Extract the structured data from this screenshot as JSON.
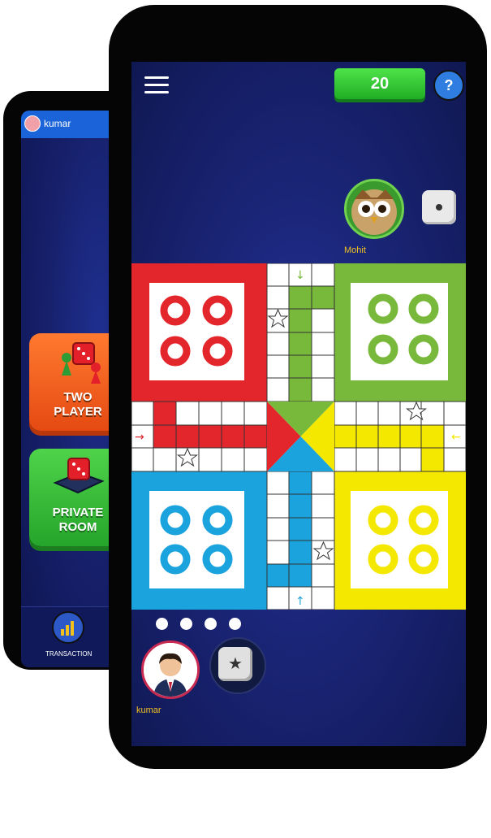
{
  "back_screen": {
    "username": "kumar",
    "modes": [
      {
        "label_line1": "TWO",
        "label_line2": "PLAYER"
      },
      {
        "label_line1": "PRIVATE",
        "label_line2": "ROOM"
      }
    ],
    "bottom_nav": {
      "transaction_label": "TRANSACTION"
    }
  },
  "game_screen": {
    "coins": "20",
    "help_icon": "question-icon",
    "opponent": {
      "name": "Mohit"
    },
    "player": {
      "name": "kumar"
    },
    "colors": {
      "red": "#e3262c",
      "green": "#78b93c",
      "blue": "#1aa3dc",
      "yellow": "#f4e700"
    }
  }
}
